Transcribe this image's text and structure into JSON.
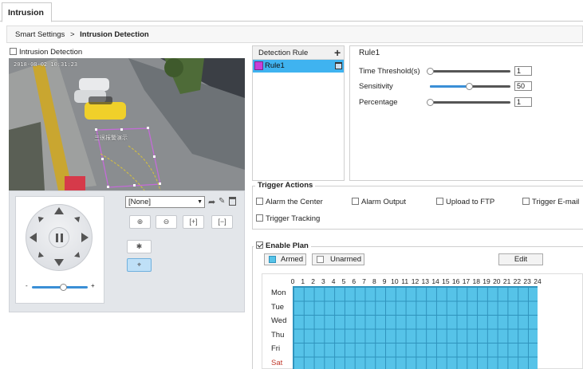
{
  "tab": {
    "label": "Intrusion"
  },
  "breadcrumb": {
    "parent": "Smart Settings",
    "separator": ">",
    "current": "Intrusion Detection"
  },
  "enable_checkbox": {
    "label": "Intrusion Detection",
    "checked": false
  },
  "video": {
    "timestamp": "2018-08-02 10:31:23",
    "overlay_text": "三很报警演示"
  },
  "ptz": {
    "preset_value": "[None]",
    "zoom_minus_label": "-",
    "zoom_plus_label": "+",
    "zoom_level": 0.55
  },
  "detection_rule": {
    "header": "Detection Rule",
    "add_symbol": "+",
    "rules": [
      {
        "name": "Rule1",
        "color": "#c73fd8",
        "selected": true
      }
    ]
  },
  "rule_settings": {
    "title": "Rule1",
    "time_threshold": {
      "label": "Time Threshold(s)",
      "value": "1",
      "level": 0.0
    },
    "sensitivity": {
      "label": "Sensitivity",
      "value": "50",
      "level": 0.5
    },
    "percentage": {
      "label": "Percentage",
      "value": "1",
      "level": 0.0
    }
  },
  "trigger_actions": {
    "title": "Trigger Actions",
    "options": [
      {
        "label": "Alarm the Center",
        "checked": false
      },
      {
        "label": "Alarm Output",
        "checked": false
      },
      {
        "label": "Upload to FTP",
        "checked": false
      },
      {
        "label": "Trigger E-mail",
        "checked": false
      },
      {
        "label": "Trigger Tracking",
        "checked": false
      }
    ]
  },
  "plan": {
    "title": "Enable Plan",
    "enabled": true,
    "armed_label": "Armed",
    "unarmed_label": "Unarmed",
    "edit_label": "Edit",
    "armed_color": "#56c3e8",
    "hours": [
      "0",
      "1",
      "2",
      "3",
      "4",
      "5",
      "6",
      "7",
      "8",
      "9",
      "10",
      "11",
      "12",
      "13",
      "14",
      "15",
      "16",
      "17",
      "18",
      "19",
      "20",
      "21",
      "22",
      "23",
      "24"
    ],
    "days": [
      "Mon",
      "Tue",
      "Wed",
      "Thu",
      "Fri",
      "Sat"
    ]
  }
}
